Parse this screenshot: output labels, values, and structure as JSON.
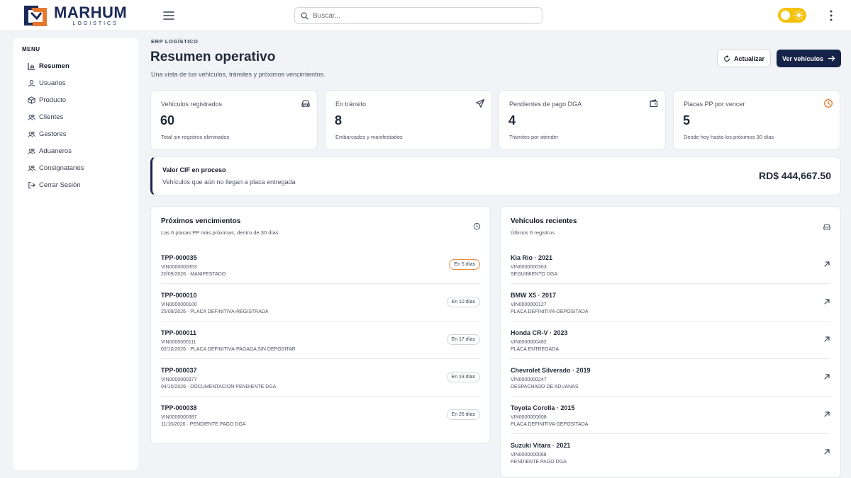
{
  "brand": {
    "name": "MARHUM",
    "sub": "LOGISTICS"
  },
  "header": {
    "search_placeholder": "Buscar..."
  },
  "sidebar": {
    "title": "MENU",
    "items": [
      {
        "label": "Resumen",
        "icon": "chart-icon",
        "active": true
      },
      {
        "label": "Usuarios",
        "icon": "user-icon"
      },
      {
        "label": "Producto",
        "icon": "box-icon"
      },
      {
        "label": "Clientes",
        "icon": "users-icon"
      },
      {
        "label": "Gestores",
        "icon": "users-icon"
      },
      {
        "label": "Aduaneros",
        "icon": "users-icon"
      },
      {
        "label": "Consignatarios",
        "icon": "users-icon"
      },
      {
        "label": "Cerrar Sesión",
        "icon": "logout-icon"
      }
    ]
  },
  "page": {
    "eyebrow": "ERP LOGÍSTICO",
    "title": "Resumen operativo",
    "subtitle": "Una vista de tus vehículos, trámites y próximos vencimientos.",
    "refresh_label": "Actualizar",
    "primary_label": "Ver vehículos"
  },
  "stats": [
    {
      "label": "Vehículos registrados",
      "value": "60",
      "desc": "Total sin registros eliminados",
      "icon": "car-icon"
    },
    {
      "label": "En tránsito",
      "value": "8",
      "desc": "Embarcados y manifestados",
      "icon": "send-icon"
    },
    {
      "label": "Pendientes de pago DGA",
      "value": "4",
      "desc": "Trámites por atender",
      "icon": "wallet-icon"
    },
    {
      "label": "Placas PP por vencer",
      "value": "5",
      "desc": "Desde hoy hasta los próximos 30 días",
      "icon": "clock-icon"
    }
  ],
  "cif": {
    "title": "Valor CIF en proceso",
    "subtitle": "Vehículos que aún no llegan a placa entregada",
    "amount": "RD$ 444,667.50"
  },
  "expirations": {
    "title": "Próximos vencimientos",
    "subtitle": "Las 6 placas PP más próximas, dentro de 30 días",
    "items": [
      {
        "plate": "TPP-000035",
        "vin": "VIN0000000353",
        "info": "20/09/2026 · MANIFESTADO",
        "badge": "En 5 días"
      },
      {
        "plate": "TPP-000010",
        "vin": "VIN0000000100",
        "info": "25/09/2026 · PLACA DEFINITIVA-REGISTRADA",
        "badge": "En 10 días"
      },
      {
        "plate": "TPP-000011",
        "vin": "VIN0000000111",
        "info": "02/10/2026 · PLACA DEFINITIVA-PAGADA SIN DEPOSITAR",
        "badge": "En 17 días"
      },
      {
        "plate": "TPP-000037",
        "vin": "VIN0000000377",
        "info": "04/10/2026 · DOCUMENTACION PENDIENTE DGA",
        "badge": "En 19 días"
      },
      {
        "plate": "TPP-000038",
        "vin": "VIN0000000387",
        "info": "11/10/2026 · PENDIENTE PAGO DGA",
        "badge": "En 26 días"
      }
    ]
  },
  "recent": {
    "title": "Vehículos recientes",
    "subtitle": "Últimos 6 registros",
    "items": [
      {
        "name": "Kia Rio · 2021",
        "vin": "VIN0000000363",
        "status": "SEGUIMIENTO DGA"
      },
      {
        "name": "BMW X5 · 2017",
        "vin": "VIN0000000127",
        "status": "PLACA DEFINITIVA-DEPOSITADA"
      },
      {
        "name": "Honda CR-V · 2023",
        "vin": "VIN0000000482",
        "status": "PLACA ENTREGADA"
      },
      {
        "name": "Chevrolet Silverado · 2019",
        "vin": "VIN0000000247",
        "status": "DESPACHADO DE ADUANAS"
      },
      {
        "name": "Toyota Corolla · 2015",
        "vin": "VIN0000000608",
        "status": "PLACA DEFINITIVA-DEPOSITADA"
      },
      {
        "name": "Suzuki Vitara · 2021",
        "vin": "VIN0000000068",
        "status": "PENDIENTE PAGO DGA"
      }
    ]
  },
  "colors": {
    "brand": "#1a2a57",
    "accent": "#e8772e",
    "toggle": "#f4c20d",
    "primary": "#162349"
  }
}
